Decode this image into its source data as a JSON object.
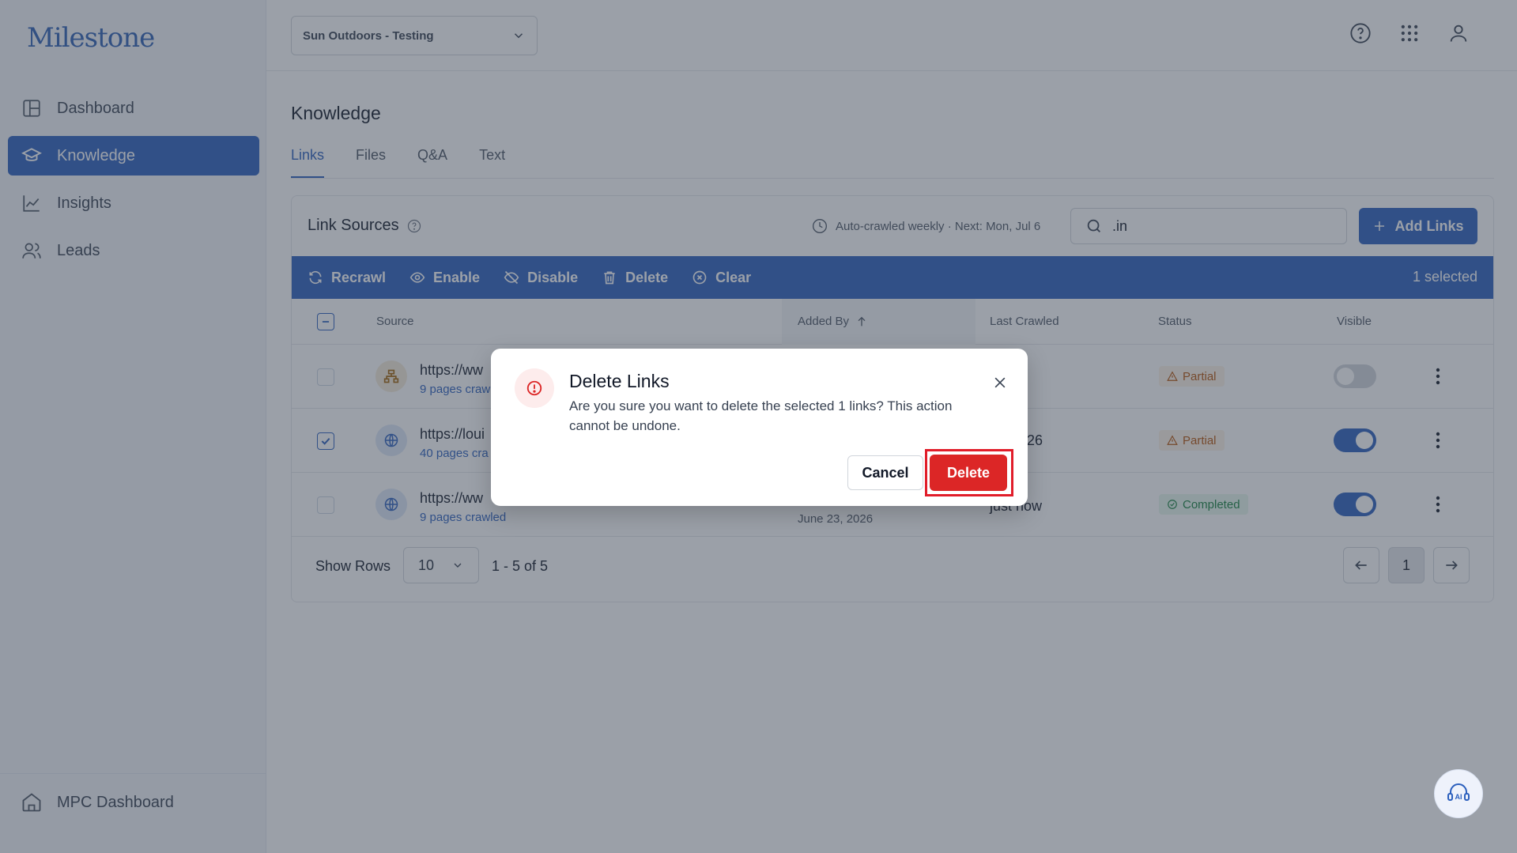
{
  "brand": {
    "logo_text": "Milestone",
    "accent": "#2b5fbd"
  },
  "sidebar": {
    "items": [
      {
        "label": "Dashboard",
        "icon": "layout-icon",
        "active": false
      },
      {
        "label": "Knowledge",
        "icon": "graduation-cap-icon",
        "active": true
      },
      {
        "label": "Insights",
        "icon": "line-chart-icon",
        "active": false
      },
      {
        "label": "Leads",
        "icon": "users-icon",
        "active": false
      }
    ],
    "bottom": {
      "label": "MPC Dashboard",
      "icon": "home-icon"
    }
  },
  "topbar": {
    "org_selected": "Sun Outdoors - Testing",
    "icons": [
      "help-icon",
      "apps-grid-icon",
      "user-icon"
    ]
  },
  "page": {
    "title": "Knowledge",
    "tabs": [
      {
        "label": "Links",
        "active": true
      },
      {
        "label": "Files",
        "active": false
      },
      {
        "label": "Q&A",
        "active": false
      },
      {
        "label": "Text",
        "active": false
      }
    ]
  },
  "link_sources": {
    "title": "Link Sources",
    "auto_crawl": "Auto-crawled weekly · Next: Mon, Jul 6",
    "search_value": ".in",
    "add_button": "Add Links",
    "actions": [
      "Recrawl",
      "Enable",
      "Disable",
      "Delete",
      "Clear"
    ],
    "selected_count": "1 selected",
    "columns": {
      "source": "Source",
      "added_by": "Added By",
      "last_crawled": "Last Crawled",
      "status": "Status",
      "visible": "Visible"
    },
    "rows": [
      {
        "url": "https://ww",
        "sub": "9 pages craw",
        "added_by": "",
        "added_date": "",
        "last_crawled": "ow",
        "status": "Partial",
        "visible": false,
        "checked": false,
        "icon": "sitemap-icon"
      },
      {
        "url": "https://loui",
        "sub": "40 pages cra",
        "added_by": "",
        "added_date": "",
        "last_crawled": "24, 2026",
        "status": "Partial",
        "visible": true,
        "checked": true,
        "icon": "globe-icon"
      },
      {
        "url": "https://ww",
        "sub": "9 pages crawled",
        "added_by": "",
        "added_date": "June 23, 2026",
        "last_crawled": "just now",
        "status": "Completed",
        "visible": true,
        "checked": false,
        "icon": "globe-icon"
      }
    ],
    "footer": {
      "show_rows_label": "Show Rows",
      "rows_value": "10",
      "range": "1 - 5 of 5",
      "current_page": "1"
    }
  },
  "modal": {
    "title": "Delete Links",
    "message": "Are you sure you want to delete the selected 1 links? This action cannot be undone.",
    "cancel_label": "Cancel",
    "delete_label": "Delete"
  },
  "fab": {
    "label": "AI",
    "icon": "ai-assistant-icon"
  }
}
